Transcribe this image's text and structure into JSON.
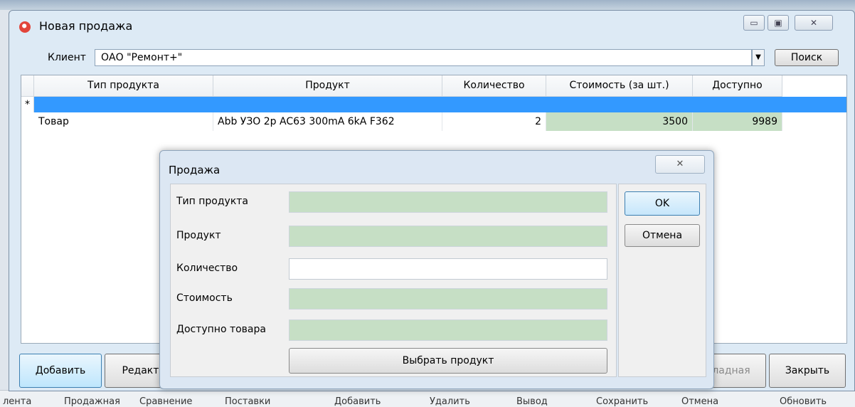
{
  "window": {
    "title": "Новая продажа",
    "controls": {
      "minimize": "▭",
      "maximize": "▣",
      "close": "✕"
    }
  },
  "client": {
    "label": "Клиент",
    "value": "ОАО \"Ремонт+\"",
    "dropdown_glyph": "▼",
    "search_label": "Поиск"
  },
  "grid": {
    "columns": [
      "Тип продукта",
      "Продукт",
      "Количество",
      "Стоимость (за шт.)",
      "Доступно"
    ],
    "new_row_marker": "*",
    "rows": [
      {
        "type": "Товар",
        "product": "Abb УЗО 2p AC63 300mA 6kA F362",
        "qty": "2",
        "price": "3500",
        "available": "9989"
      }
    ]
  },
  "bottom_buttons": {
    "add": "Добавить",
    "edit": "Редакти",
    "invoice": "ладная",
    "close": "Закрыть"
  },
  "background": {
    "bottom_menu": [
      "лента",
      "Продажная",
      "Сравнение",
      "Поставки",
      "Добавить",
      "Удалить",
      "Вывод",
      "Сохранить",
      "Отмена",
      "Обновить"
    ]
  },
  "dialog": {
    "title": "Продажа",
    "close_glyph": "✕",
    "fields": {
      "product_type": "Тип продукта",
      "product": "Продукт",
      "quantity": "Количество",
      "price": "Стоимость",
      "available": "Доступно товара"
    },
    "pick_button": "Выбрать продукт",
    "ok": "OK",
    "cancel": "Отмена"
  },
  "colors": {
    "selection": "#3399ff",
    "readonly_field": "#c6dfc5"
  }
}
